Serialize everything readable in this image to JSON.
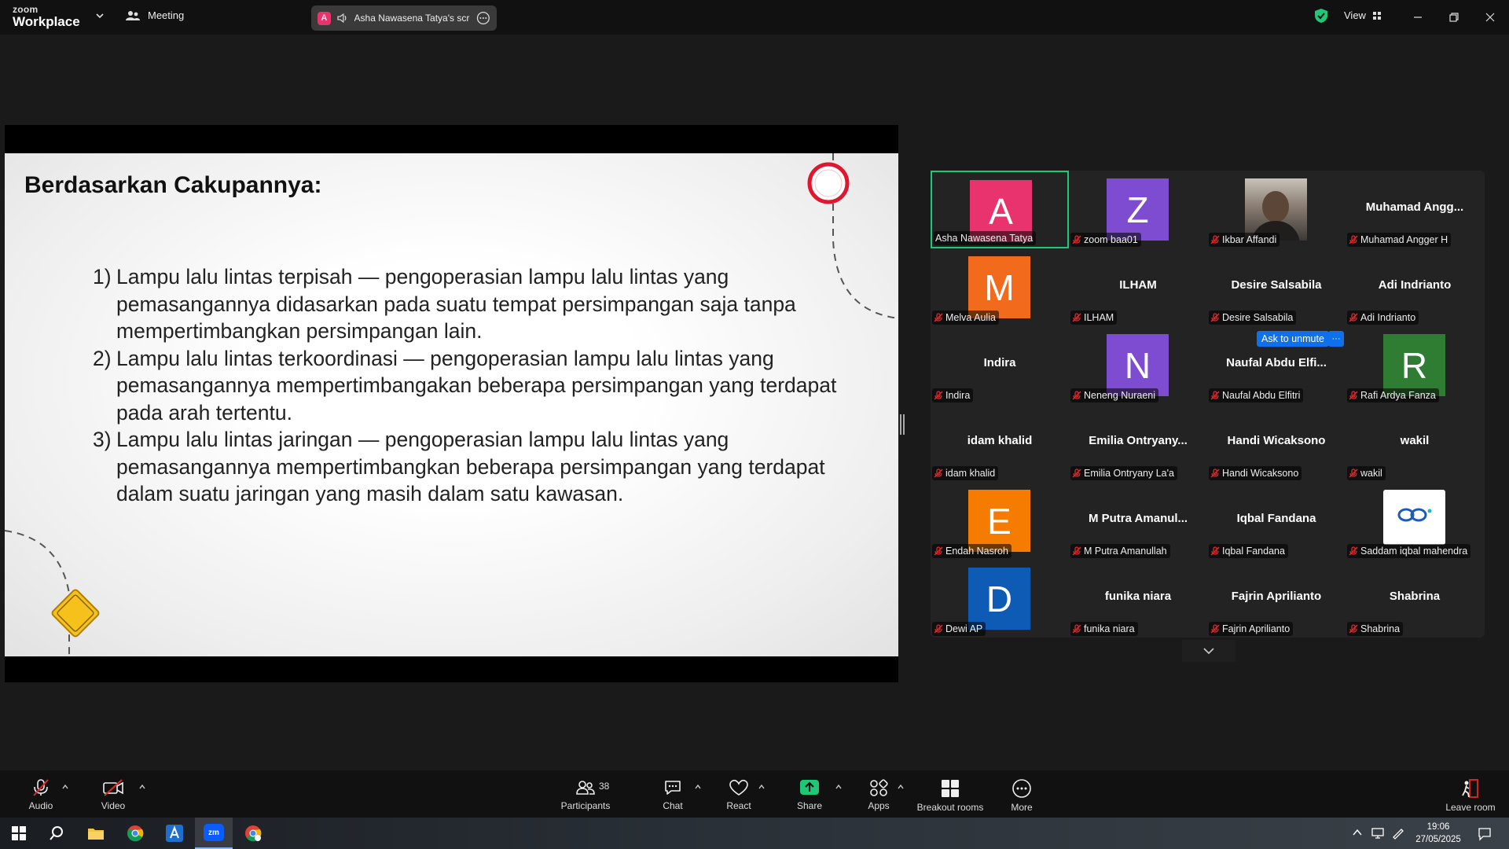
{
  "app": {
    "brand_small": "zoom",
    "brand_large": "Workplace",
    "meeting_label": "Meeting",
    "share_badge": "A",
    "share_text": "Asha Nawasena Tatya's screen",
    "view_label": "View",
    "accent_color": "#0e71eb",
    "active_speaker_color": "#1ec876"
  },
  "slide": {
    "title": "Berdasarkan Cakupannya:",
    "items": [
      {
        "num": "1)",
        "text": "Lampu lalu lintas terpisah — pengoperasian lampu lalu lintas yang pemasangannya didasarkan pada suatu tempat persimpangan saja tanpa mempertimbangkan persimpangan lain."
      },
      {
        "num": "2)",
        "text": "Lampu lalu lintas terkoordinasi — pengoperasian lampu lalu lintas yang pemasangannya mempertimbangakan beberapa persimpangan yang terdapat pada arah tertentu."
      },
      {
        "num": "3)",
        "text": "Lampu lalu lintas jaringan — pengoperasian lampu lalu lintas yang pemasangannya mempertimbangkan beberapa persimpangan yang terdapat dalam suatu jaringan yang masih dalam satu kawasan."
      }
    ]
  },
  "gallery": {
    "ask_unmute": "Ask to unmute",
    "ask_more": "···",
    "participants": [
      {
        "name": "Asha Nawasena Tatya",
        "type": "avatar",
        "letter": "A",
        "color": "#e8336e",
        "muted": false,
        "active": true
      },
      {
        "name": "zoom baa01",
        "type": "avatar",
        "letter": "Z",
        "color": "#7d4cd1",
        "muted": true
      },
      {
        "name": "Ikbar Affandi",
        "type": "photo",
        "muted": true
      },
      {
        "name": "Muhamad Angger H",
        "type": "name",
        "display": "Muhamad  Angg...",
        "muted": true
      },
      {
        "name": "Melva Aulia",
        "type": "avatar",
        "letter": "M",
        "color": "#f26a1b",
        "muted": true
      },
      {
        "name": "ILHAM",
        "type": "name",
        "display": "ILHAM",
        "muted": true
      },
      {
        "name": "Desire Salsabila",
        "type": "name",
        "display": "Desire Salsabila",
        "muted": true
      },
      {
        "name": "Adi Indrianto",
        "type": "name",
        "display": "Adi Indrianto",
        "muted": true
      },
      {
        "name": "Indira",
        "type": "name",
        "display": "Indira",
        "muted": true
      },
      {
        "name": "Neneng Nuraeni",
        "type": "avatar",
        "letter": "N",
        "color": "#7d4cd1",
        "muted": true
      },
      {
        "name": "Naufal Abdu Elfitri",
        "type": "name",
        "display": "Naufal Abdu Elfi...",
        "muted": true
      },
      {
        "name": "Rafi Ardya Fanza",
        "type": "avatar",
        "letter": "R",
        "color": "#2e7d32",
        "muted": true
      },
      {
        "name": "idam khalid",
        "type": "name",
        "display": "idam khalid",
        "muted": true
      },
      {
        "name": "Emilia Ontryany La'a",
        "type": "name",
        "display": "Emilia  Ontryany...",
        "muted": true
      },
      {
        "name": "Handi Wicaksono",
        "type": "name",
        "display": "Handi Wicaksono",
        "muted": true
      },
      {
        "name": "wakil",
        "type": "name",
        "display": "wakil",
        "muted": true
      },
      {
        "name": "Endah Nasroh",
        "type": "avatar",
        "letter": "E",
        "color": "#f57c00",
        "muted": true
      },
      {
        "name": "M Putra Amanullah",
        "type": "name",
        "display": "M Putra  Amanul...",
        "muted": true
      },
      {
        "name": "Iqbal Fandana",
        "type": "name",
        "display": "Iqbal Fandana",
        "muted": true
      },
      {
        "name": "Saddam iqbal mahendra",
        "type": "logo",
        "muted": true
      },
      {
        "name": "Dewi AP",
        "type": "avatar",
        "letter": "D",
        "color": "#0d5bb5",
        "muted": true
      },
      {
        "name": "funika niara",
        "type": "name",
        "display": "funika niara",
        "muted": true
      },
      {
        "name": "Fajrin Aprilianto",
        "type": "name",
        "display": "Fajrin Aprilianto",
        "muted": true
      },
      {
        "name": "Shabrina",
        "type": "name",
        "display": "Shabrina",
        "muted": true
      }
    ]
  },
  "toolbar": {
    "audio": "Audio",
    "video": "Video",
    "participants": "Participants",
    "participants_count": "38",
    "chat": "Chat",
    "react": "React",
    "share": "Share",
    "apps": "Apps",
    "breakout": "Breakout rooms",
    "more": "More",
    "leave": "Leave room",
    "share_color": "#1ec876"
  },
  "taskbar": {
    "time": "19:06",
    "date": "27/05/2025",
    "zoom_label": "zm"
  }
}
